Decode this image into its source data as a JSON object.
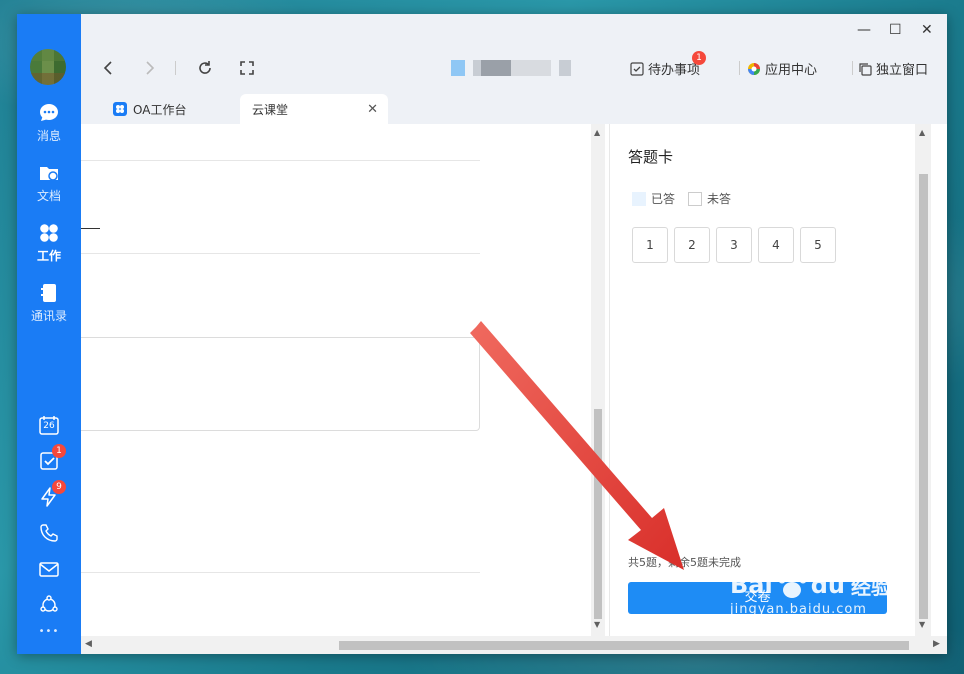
{
  "sidebar": {
    "items": [
      {
        "label": "消息",
        "icon": "chat-bubble-icon"
      },
      {
        "label": "文档",
        "icon": "folder-cloud-icon"
      },
      {
        "label": "工作",
        "icon": "grid-clover-icon"
      },
      {
        "label": "通讯录",
        "icon": "address-book-icon"
      }
    ],
    "calendar_day": "26",
    "tasks_badge": "1",
    "flash_badge": "9",
    "more_label": "•••"
  },
  "topbar": {
    "todo_label": "待办事项",
    "todo_badge": "1",
    "app_center_label": "应用中心",
    "standalone_label": "独立窗口"
  },
  "tabs": [
    {
      "label": "OA工作台"
    },
    {
      "label": "云课堂",
      "close": "✕"
    }
  ],
  "window_controls": {
    "minimize": "—",
    "maximize": "☐",
    "close": "✕"
  },
  "answer_card": {
    "title": "答题卡",
    "legend_answered": "已答",
    "legend_unanswered": "未答",
    "questions": [
      "1",
      "2",
      "3",
      "4",
      "5"
    ],
    "summary": "共5题，剩余5题未完成",
    "submit_label": "交卷"
  },
  "watermark": {
    "brand": "Bai",
    "brand2": "du",
    "suffix": "经验",
    "url": "jingyan.baidu.com"
  },
  "colors": {
    "sidebar": "#1a7cf5",
    "accent": "#1e8cf5",
    "badge": "#f5483b",
    "annotation_arrow": "#e8413f"
  }
}
